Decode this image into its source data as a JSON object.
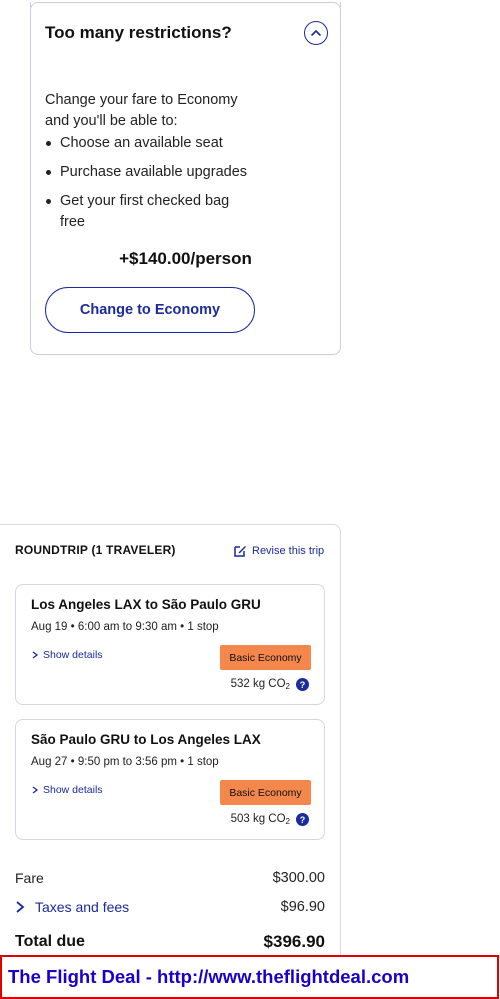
{
  "upsell": {
    "title": "Too many restrictions?",
    "intro": "Change your fare to Economy and you'll be able to:",
    "benefits": [
      "Choose an available seat",
      "Purchase available upgrades",
      "Get your first checked bag free"
    ],
    "price": "+$140.00/person",
    "button_label": "Change to Economy"
  },
  "trip": {
    "title": "ROUNDTRIP (1 TRAVELER)",
    "revise_label": "Revise this trip",
    "flights": [
      {
        "route": "Los Angeles LAX to São Paulo GRU",
        "meta": "Aug 19 • 6:00 am to 9:30 am • 1 stop",
        "details_label": "Show details",
        "fare_class": "Basic Economy",
        "co2": "532 kg CO",
        "co2_sub": "2"
      },
      {
        "route": "São Paulo GRU to Los Angeles LAX",
        "meta": "Aug 27 • 9:50 pm to 3:56 pm • 1 stop",
        "details_label": "Show details",
        "fare_class": "Basic Economy",
        "co2": "503 kg CO",
        "co2_sub": "2"
      }
    ],
    "fare": {
      "label": "Fare",
      "value": "$300.00"
    },
    "taxes": {
      "label": "Taxes and fees",
      "value": "$96.90"
    },
    "total": {
      "label": "Total due",
      "value": "$396.90"
    }
  },
  "colors": {
    "accent": "#1b2a9c",
    "badge": "#f4874b",
    "watermark_border": "#e00000",
    "watermark_text": "#1a00c8"
  },
  "watermark": {
    "text": "The Flight Deal - http://www.theflightdeal.com"
  }
}
